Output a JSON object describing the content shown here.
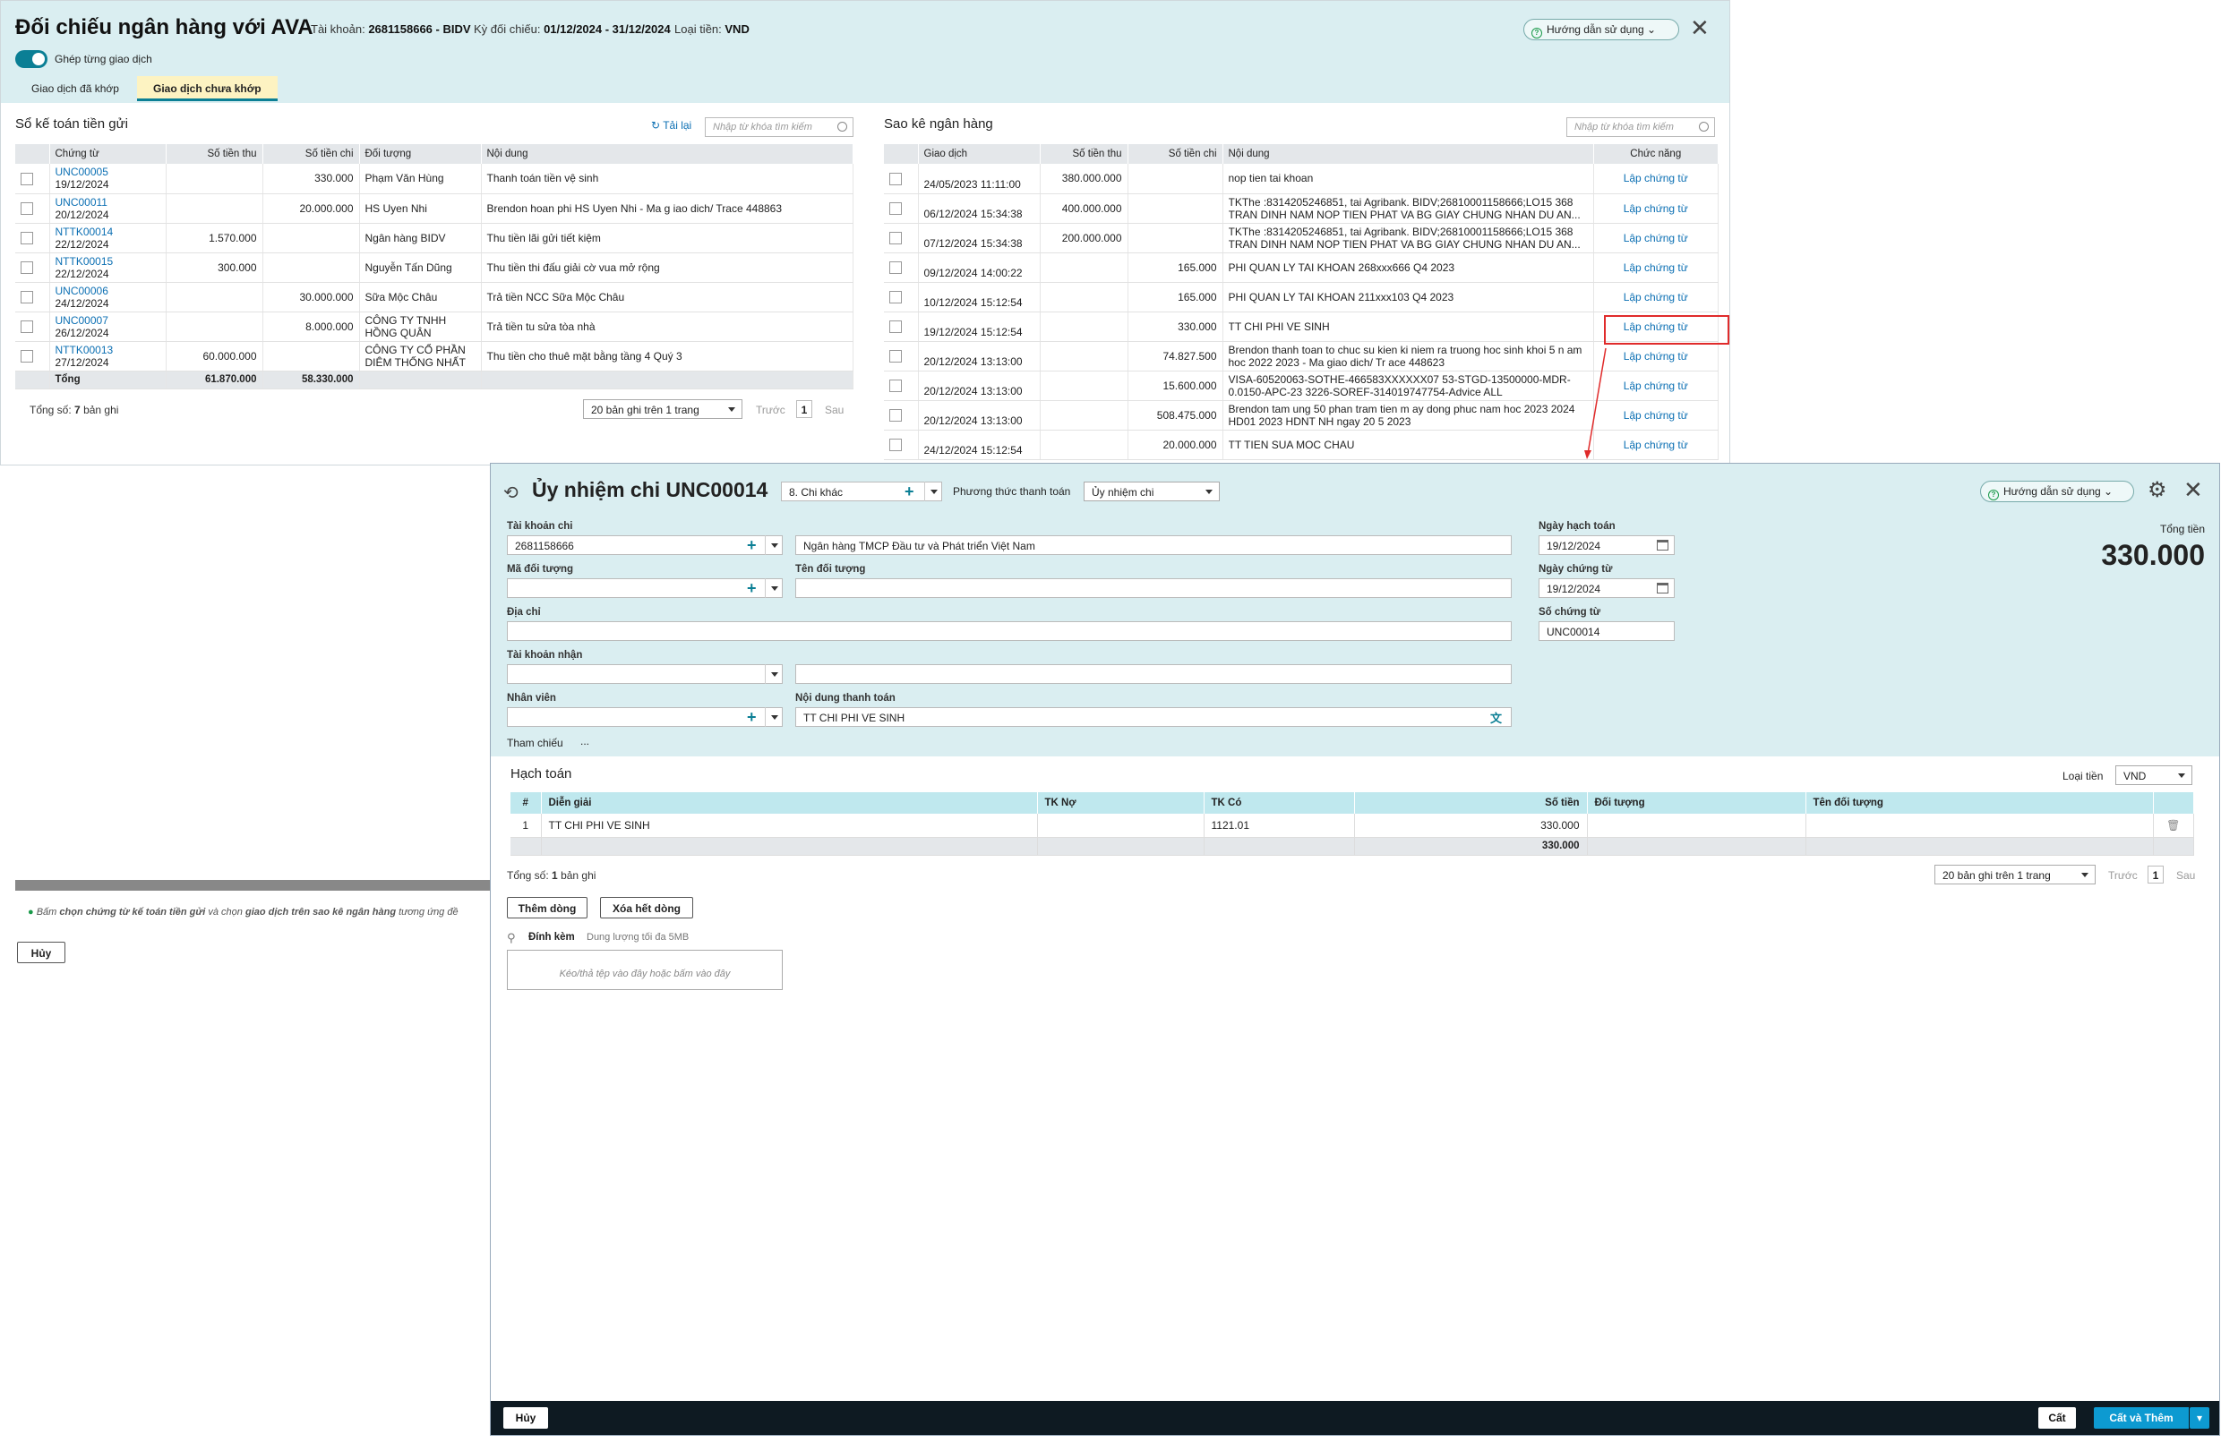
{
  "recon": {
    "title": "Đối chiếu ngân hàng với AVA",
    "account_label": "Tài khoản:",
    "account_value": "2681158666 - BIDV",
    "period_label": "Kỳ đối chiếu:",
    "period_value": "01/12/2024 - 31/12/2024",
    "currency_label": "Loại tiền:",
    "currency_value": "VND",
    "help_label": "Hướng dẫn sử dụng",
    "toggle_label": "Ghép từng giao dịch",
    "tabs": [
      "Giao dịch đã khớp",
      "Giao dịch chưa khớp"
    ],
    "left": {
      "title": "Sổ kế toán tiền gửi",
      "reload_label": "Tải lại",
      "search_placeholder": "Nhập từ khóa tìm kiếm",
      "columns": [
        "Chứng từ",
        "Số tiền thu",
        "Số tiền chi",
        "Đối tượng",
        "Nội dung"
      ],
      "rows": [
        {
          "code": "UNC00005",
          "date": "19/12/2024",
          "in": "",
          "out": "330.000",
          "party": "Phạm Văn Hùng",
          "content": "Thanh toán tiền vệ sinh"
        },
        {
          "code": "UNC00011",
          "date": "20/12/2024",
          "in": "",
          "out": "20.000.000",
          "party": "HS Uyen Nhi",
          "content": "Brendon hoan phi HS Uyen Nhi - Ma g iao dich/ Trace 448863"
        },
        {
          "code": "NTTK00014",
          "date": "22/12/2024",
          "in": "1.570.000",
          "out": "",
          "party": "Ngân hàng BIDV",
          "content": "Thu tiền lãi gửi tiết kiệm"
        },
        {
          "code": "NTTK00015",
          "date": "22/12/2024",
          "in": "300.000",
          "out": "",
          "party": "Nguyễn Tấn Dũng",
          "content": "Thu tiền thi đấu giải cờ vua mở rộng"
        },
        {
          "code": "UNC00006",
          "date": "24/12/2024",
          "in": "",
          "out": "30.000.000",
          "party": "Sữa Mộc Châu",
          "content": "Trả tiền NCC Sữa Mộc Châu"
        },
        {
          "code": "UNC00007",
          "date": "26/12/2024",
          "in": "",
          "out": "8.000.000",
          "party": "CÔNG TY TNHH HỒNG QUÂN",
          "content": "Trả tiền tu sửa tòa nhà"
        },
        {
          "code": "NTTK00013",
          "date": "27/12/2024",
          "in": "60.000.000",
          "out": "",
          "party": "CÔNG TY CỔ PHẦN DIÊM THỐNG NHẤT",
          "content": "Thu tiền cho thuê mặt bằng tầng 4 Quý 3"
        }
      ],
      "total_label": "Tổng",
      "total_in": "61.870.000",
      "total_out": "58.330.000",
      "count_prefix": "Tổng số:",
      "count_value": "7",
      "count_suffix": "bản ghi",
      "page_size": "20 bản ghi trên 1 trang",
      "prev": "Trước",
      "page": "1",
      "next": "Sau"
    },
    "right": {
      "title": "Sao kê ngân hàng",
      "search_placeholder": "Nhập từ khóa tìm kiếm",
      "columns": [
        "Giao dịch",
        "Số tiền thu",
        "Số tiền chi",
        "Nội dung",
        "Chức năng"
      ],
      "rows": [
        {
          "date": "24/05/2023 11:11:00",
          "in": "380.000.000",
          "out": "",
          "content": "nop tien tai khoan",
          "action": "Lập chứng từ"
        },
        {
          "date": "06/12/2024 15:34:38",
          "in": "400.000.000",
          "out": "",
          "content": "TKThe :8314205246851, tai Agribank. BIDV;26810001158666;LO15 368 TRAN DINH NAM NOP TIEN PHAT VA BG GIAY CHUNG NHAN DU AN...",
          "action": "Lập chứng từ"
        },
        {
          "date": "07/12/2024 15:34:38",
          "in": "200.000.000",
          "out": "",
          "content": "TKThe :8314205246851, tai Agribank. BIDV;26810001158666;LO15 368 TRAN DINH NAM NOP TIEN PHAT VA BG GIAY CHUNG NHAN DU AN...",
          "action": "Lập chứng từ"
        },
        {
          "date": "09/12/2024 14:00:22",
          "in": "",
          "out": "165.000",
          "content": "PHI QUAN LY TAI KHOAN 268xxx666 Q4 2023",
          "action": "Lập chứng từ"
        },
        {
          "date": "10/12/2024 15:12:54",
          "in": "",
          "out": "165.000",
          "content": "PHI QUAN LY TAI KHOAN 211xxx103 Q4 2023",
          "action": "Lập chứng từ"
        },
        {
          "date": "19/12/2024 15:12:54",
          "in": "",
          "out": "330.000",
          "content": "TT CHI PHI VE SINH",
          "action": "Lập chứng từ"
        },
        {
          "date": "20/12/2024 13:13:00",
          "in": "",
          "out": "74.827.500",
          "content": "Brendon thanh toan to chuc su kien ki niem ra truong hoc sinh khoi 5 n am hoc 2022 2023 - Ma giao dich/ Tr ace 448623",
          "action": "Lập chứng từ"
        },
        {
          "date": "20/12/2024 13:13:00",
          "in": "",
          "out": "15.600.000",
          "content": "VISA-60520063-SOTHE-466583XXXXXX07 53-STGD-13500000-MDR-0.0150-APC-23 3226-SOREF-314019747754-Advice ALL",
          "action": "Lập chứng từ"
        },
        {
          "date": "20/12/2024 13:13:00",
          "in": "",
          "out": "508.475.000",
          "content": "Brendon tam ung 50 phan tram tien m ay dong phuc nam hoc 2023 2024 HD01 2023 HDNT NH ngay 20 5 2023",
          "action": "Lập chứng từ"
        },
        {
          "date": "24/12/2024 15:12:54",
          "in": "",
          "out": "20.000.000",
          "content": "TT TIEN SUA MOC CHAU",
          "action": "Lập chứng từ"
        }
      ]
    },
    "note_prefix": "Bấm",
    "note_bold1": "chọn chứng từ kế toán tiền gửi",
    "note_mid": "và chọn",
    "note_bold2": "giao dịch trên sao kê ngân hàng",
    "note_suffix": "tương ứng đề",
    "cancel_label": "Hủy"
  },
  "voucher": {
    "title": "Ủy nhiệm chi UNC00014",
    "type_value": "8. Chi khác",
    "method_label": "Phương thức thanh toán",
    "method_value": "Ủy nhiệm chi",
    "help_label": "Hướng dẫn sử dụng",
    "fields": {
      "pay_account_label": "Tài khoản chi",
      "pay_account_value": "2681158666",
      "bank_name_value": "Ngân hàng TMCP Đầu tư và Phát triển Việt Nam",
      "party_code_label": "Mã đối tượng",
      "party_code_value": "",
      "party_name_label": "Tên đối tượng",
      "party_name_value": "",
      "address_label": "Địa chỉ",
      "address_value": "",
      "recv_account_label": "Tài khoản nhận",
      "recv_account_value": "",
      "recv_bank_value": "",
      "employee_label": "Nhân viên",
      "employee_value": "",
      "content_label": "Nội dung thanh toán",
      "content_value": "TT CHI PHI VE SINH",
      "reference_label": "Tham chiếu",
      "reference_more": "...",
      "posting_date_label": "Ngày hạch toán",
      "posting_date_value": "19/12/2024",
      "voucher_date_label": "Ngày chứng từ",
      "voucher_date_value": "19/12/2024",
      "voucher_no_label": "Số chứng từ",
      "voucher_no_value": "UNC00014",
      "total_label": "Tổng tiền",
      "total_value": "330.000"
    },
    "accounting": {
      "title": "Hạch toán",
      "currency_label": "Loại tiền",
      "currency_value": "VND",
      "columns": [
        "#",
        "Diễn giải",
        "TK Nợ",
        "TK Có",
        "Số tiền",
        "Đối tượng",
        "Tên đối tượng"
      ],
      "rows": [
        {
          "no": "1",
          "desc": "TT CHI PHI VE SINH",
          "debit": "",
          "credit": "1121.01",
          "amount": "330.000",
          "party": "",
          "party_name": ""
        }
      ],
      "total_amount": "330.000",
      "count_prefix": "Tổng số:",
      "count_value": "1",
      "count_suffix": "bản ghi",
      "page_size": "20 bản ghi trên 1 trang",
      "prev": "Trước",
      "page": "1",
      "next": "Sau",
      "add_row_label": "Thêm dòng",
      "clear_all_label": "Xóa hết dòng"
    },
    "attach_label": "Đính kèm",
    "attach_hint": "Dung lượng tối đa 5MB",
    "dropzone_text": "Kéo/thả tệp vào đây hoặc bấm vào đây",
    "footer": {
      "cancel_label": "Hủy",
      "save_label": "Cất",
      "save_add_label": "Cất và Thêm"
    }
  },
  "colors": {
    "accent": "#0b7f95",
    "header_bg": "#daeef1",
    "link": "#0b6fb3",
    "highlight": "#e02b2b",
    "footer_bg": "#0e1a22"
  }
}
